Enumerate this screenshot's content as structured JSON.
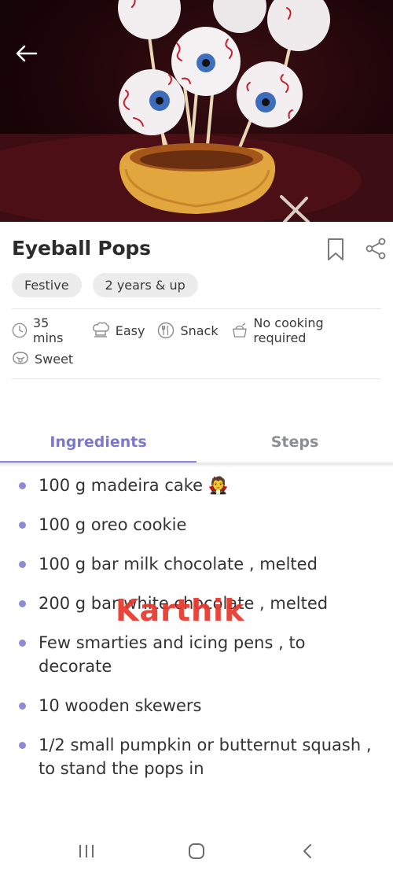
{
  "recipe": {
    "title": "Eyeball Pops",
    "tags": [
      "Festive",
      "2 years & up"
    ],
    "meta": {
      "time": "35 mins",
      "difficulty": "Easy",
      "course": "Snack",
      "cooking": "No cooking required",
      "taste": "Sweet"
    }
  },
  "tabs": {
    "ingredients": "Ingredients",
    "steps": "Steps",
    "active": "ingredients"
  },
  "ingredients": [
    "100 g madeira cake",
    "100 g oreo cookie",
    "100 g bar milk chocolate , melted",
    "200 g bar white chocolate , melted",
    "Few smarties and icing pens , to decorate",
    "10 wooden skewers",
    "1/2 small pumpkin or butternut squash , to stand the pops in"
  ],
  "ingredient_emoji": "🧛",
  "watermark": "Karthik",
  "colors": {
    "accent": "#7b78cf",
    "tab_inactive": "#8a8f95",
    "watermark": "#e8372c"
  }
}
